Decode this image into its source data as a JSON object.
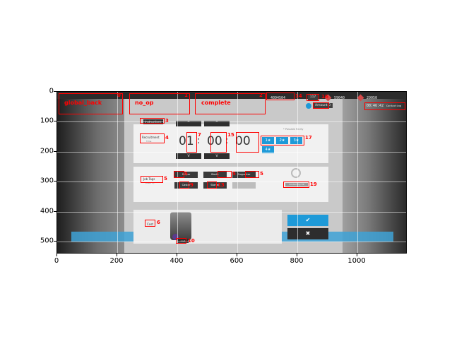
{
  "axis": {
    "x_ticks": [
      "0",
      "200",
      "400",
      "600",
      "800",
      "1000"
    ],
    "y_ticks": [
      "0",
      "100",
      "200",
      "300",
      "400",
      "500"
    ]
  },
  "annotations": [
    {
      "id": "0",
      "label": "global_back"
    },
    {
      "id": "1",
      "label": "no_op"
    },
    {
      "id": "2",
      "label": "complete"
    },
    {
      "id": "3",
      "label": ""
    },
    {
      "id": "4",
      "label": ""
    },
    {
      "id": "5",
      "label": ""
    },
    {
      "id": "6",
      "label": ""
    },
    {
      "id": "7",
      "label": ""
    },
    {
      "id": "8",
      "label": ""
    },
    {
      "id": "9",
      "label": ""
    },
    {
      "id": "10",
      "label": ""
    },
    {
      "id": "11",
      "label": ""
    },
    {
      "id": "12",
      "label": ""
    },
    {
      "id": "13",
      "label": ""
    },
    {
      "id": "14",
      "label": ""
    },
    {
      "id": "15",
      "label": ""
    },
    {
      "id": "16",
      "label": ""
    },
    {
      "id": "17",
      "label": ""
    },
    {
      "id": "18",
      "label": ""
    },
    {
      "id": "19",
      "label": ""
    }
  ],
  "hud": {
    "user_id": "4094504",
    "sanity": "117",
    "lmd": "59040",
    "orundum": "29050",
    "permit_label": "Amount",
    "permit_count": "0",
    "timer": "00:46:42",
    "status": "Contacting"
  },
  "recruit": {
    "instructions_label": "Instructions",
    "recruitment_label": "Recruitment",
    "recruitment_sub": "Time",
    "hours": "01",
    "minutes": "00",
    "seconds": "00",
    "separator": ":",
    "up_arrow": "^",
    "down_arrow": "v",
    "rarity_title": "* Possible Rarity",
    "stars": [
      "1★",
      "2★",
      "3★",
      "4★"
    ]
  },
  "tags": {
    "title": "Job Tags",
    "sub": "(Max. 3)",
    "items": [
      "Sniper",
      "Medic",
      "Supporter",
      "Caster",
      "Starter"
    ],
    "contact_hr": "Contacting HR"
  },
  "cost": {
    "label": "Cost",
    "tag": "Cost",
    "confirm": "✔",
    "cancel": "✖"
  }
}
